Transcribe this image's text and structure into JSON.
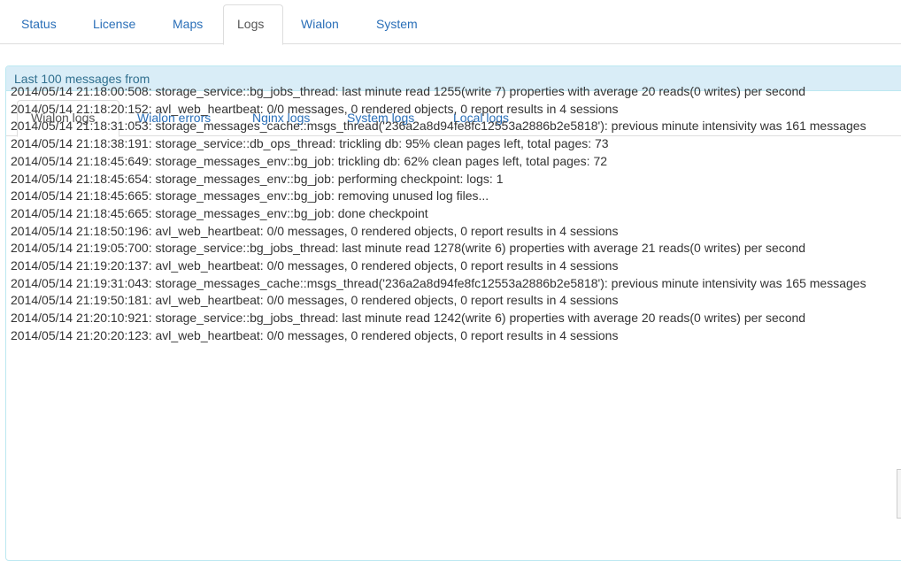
{
  "top_tabs": [
    {
      "label": "Status"
    },
    {
      "label": "License"
    },
    {
      "label": "Maps"
    },
    {
      "label": "Logs"
    },
    {
      "label": "Wialon"
    },
    {
      "label": "System"
    }
  ],
  "active_top_tab": "Logs",
  "panel": {
    "heading": "Last 100 messages from"
  },
  "sub_tabs": [
    {
      "label": "Wialon logs"
    },
    {
      "label": "Wialon errors"
    },
    {
      "label": "Nginx logs"
    },
    {
      "label": "System logs"
    },
    {
      "label": "Local logs"
    }
  ],
  "active_sub_tab": "Wialon logs",
  "log_lines": [
    "2014/05/14 21:18:00:508: storage_service::bg_jobs_thread: last minute read 1255(write 7) properties with average 20 reads(0 writes) per second",
    "2014/05/14 21:18:20:152: avl_web_heartbeat: 0/0 messages, 0 rendered objects, 0 report results in 4 sessions",
    "2014/05/14 21:18:31:053: storage_messages_cache::msgs_thread('236a2a8d94fe8fc12553a2886b2e5818'): previous minute intensivity was 161 messages",
    "2014/05/14 21:18:38:191: storage_service::db_ops_thread: trickling db: 95% clean pages left, total pages: 73",
    "2014/05/14 21:18:45:649: storage_messages_env::bg_job: trickling db: 62% clean pages left, total pages: 72",
    "2014/05/14 21:18:45:654: storage_messages_env::bg_job: performing checkpoint: logs: 1",
    "2014/05/14 21:18:45:665: storage_messages_env::bg_job: removing unused log files...",
    "2014/05/14 21:18:45:665: storage_messages_env::bg_job: done checkpoint",
    "2014/05/14 21:18:50:196: avl_web_heartbeat: 0/0 messages, 0 rendered objects, 0 report results in 4 sessions",
    "2014/05/14 21:19:05:700: storage_service::bg_jobs_thread: last minute read 1278(write 6) properties with average 21 reads(0 writes) per second",
    "2014/05/14 21:19:20:137: avl_web_heartbeat: 0/0 messages, 0 rendered objects, 0 report results in 4 sessions",
    "2014/05/14 21:19:31:043: storage_messages_cache::msgs_thread('236a2a8d94fe8fc12553a2886b2e5818'): previous minute intensivity was 165 messages",
    "2014/05/14 21:19:50:181: avl_web_heartbeat: 0/0 messages, 0 rendered objects, 0 report results in 4 sessions",
    "2014/05/14 21:20:10:921: storage_service::bg_jobs_thread: last minute read 1242(write 6) properties with average 20 reads(0 writes) per second",
    "2014/05/14 21:20:20:123: avl_web_heartbeat: 0/0 messages, 0 rendered objects, 0 report results in 4 sessions"
  ],
  "colors": {
    "link": "#2a6fb8",
    "panel_heading_bg": "#d9edf7",
    "panel_heading_text": "#31708f",
    "panel_border": "#bce8f1",
    "text": "#333333"
  }
}
